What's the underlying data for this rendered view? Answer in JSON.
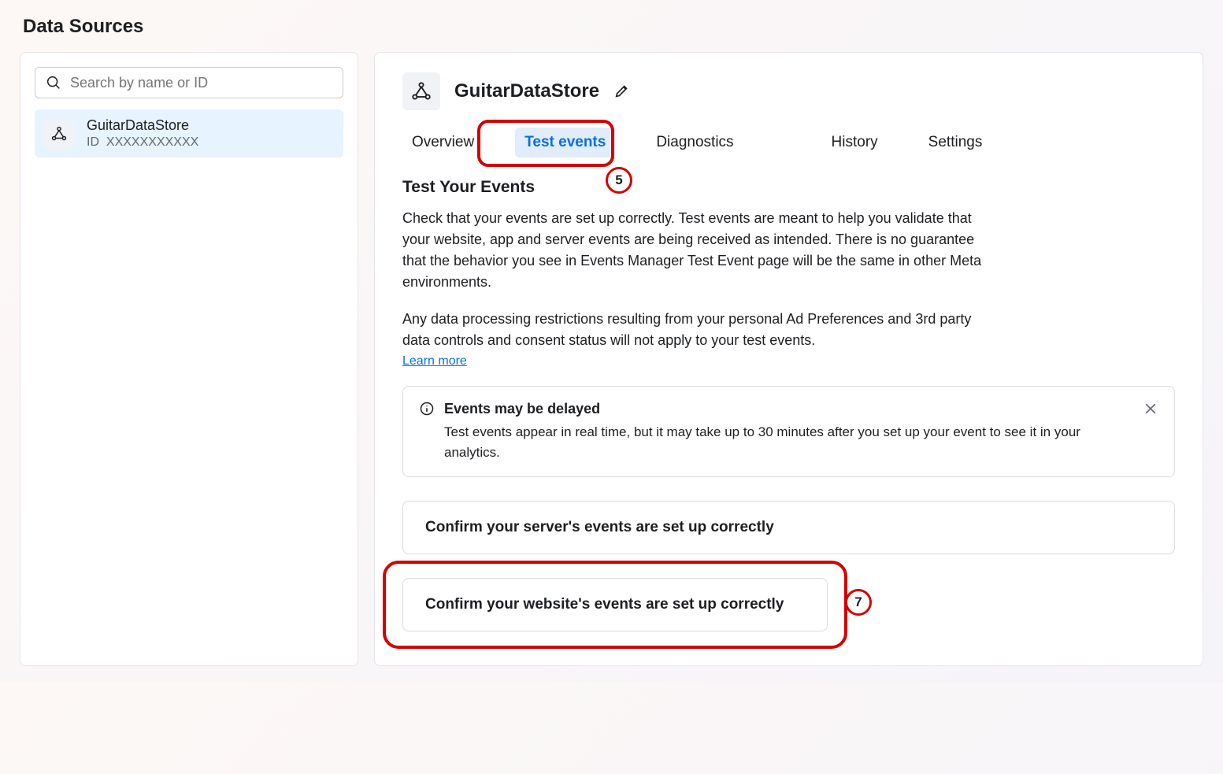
{
  "page_title": "Data Sources",
  "search": {
    "placeholder": "Search by name or ID"
  },
  "sidebar_item": {
    "name": "GuitarDataStore",
    "id_label": "ID",
    "id_value": "XXXXXXXXXXX"
  },
  "main": {
    "title": "GuitarDataStore",
    "tabs": {
      "overview": "Overview",
      "test_events": "Test events",
      "diagnostics": "Diagnostics",
      "history": "History",
      "settings": "Settings"
    },
    "section_heading": "Test Your Events",
    "para1": "Check that your events are set up correctly. Test events are meant to help you validate that your website, app and server events are being received as intended. There is no guarantee that the behavior you see in Events Manager Test Event page will be the same in other Meta environments.",
    "para2": "Any data processing restrictions resulting from your personal Ad Preferences and 3rd party data controls and consent status will not apply to your test events.",
    "learn_more": "Learn more",
    "alert": {
      "title": "Events may be delayed",
      "text": "Test events appear in real time, but it may take up to 30 minutes after you set up your event to see it in your analytics."
    },
    "card_server": "Confirm your server's events are set up correctly",
    "card_website": "Confirm your website's events are set up correctly"
  },
  "annotations": {
    "step5": "5",
    "step7": "7"
  }
}
